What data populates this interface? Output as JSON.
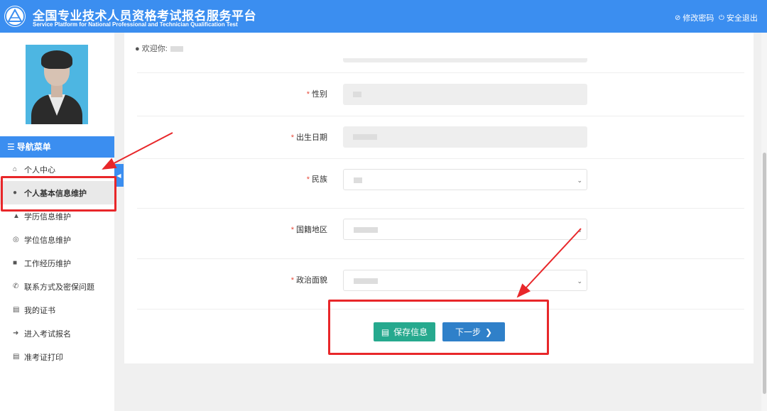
{
  "header": {
    "title_cn": "全国专业技术人员资格考试报名服务平台",
    "title_en": "Service Platform for National Professional and Technician Qualification Test",
    "change_password": "修改密码",
    "logout": "安全退出",
    "background_color": "#3b8ef0"
  },
  "sidebar": {
    "nav_title": "导航菜单",
    "items": [
      {
        "label": "个人中心",
        "icon": "home-icon"
      },
      {
        "label": "个人基本信息维护",
        "icon": "user-icon",
        "active": true
      },
      {
        "label": "学历信息维护",
        "icon": "graduation-cap-icon"
      },
      {
        "label": "学位信息维护",
        "icon": "medal-icon"
      },
      {
        "label": "工作经历维护",
        "icon": "briefcase-icon"
      },
      {
        "label": "联系方式及密保问题",
        "icon": "phone-icon"
      },
      {
        "label": "我的证书",
        "icon": "certificate-icon"
      },
      {
        "label": "进入考试报名",
        "icon": "arrow-circle-icon"
      },
      {
        "label": "准考证打印",
        "icon": "print-icon"
      }
    ]
  },
  "main": {
    "welcome": "欢迎你:",
    "form": [
      {
        "label": "性别",
        "required": true,
        "type": "readonly"
      },
      {
        "label": "出生日期",
        "required": true,
        "type": "readonly"
      },
      {
        "label": "民族",
        "required": true,
        "type": "select"
      },
      {
        "label": "国籍地区",
        "required": true,
        "type": "select"
      },
      {
        "label": "政治面貌",
        "required": true,
        "type": "select"
      }
    ],
    "save_button": "保存信息",
    "next_button": "下一步"
  },
  "colors": {
    "accent": "#3b8ef0",
    "save": "#26a98e",
    "next": "#2f80c9",
    "required": "#e74c3c",
    "annotation": "#e8272a"
  }
}
